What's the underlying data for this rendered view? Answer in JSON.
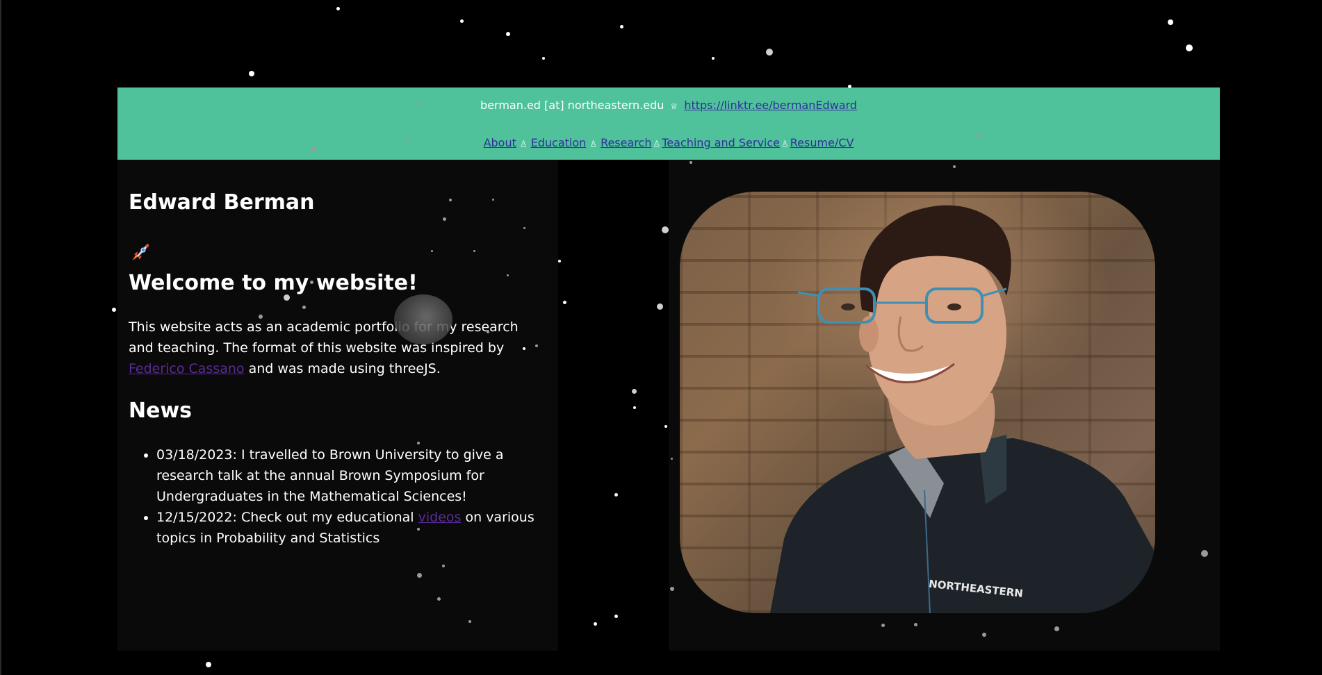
{
  "header": {
    "email": "berman.ed [at] northeastern.edu",
    "separator": "♕",
    "link": "https://linktr.ee/bermanEdward",
    "nav": [
      {
        "label": "About"
      },
      {
        "label": "Education"
      },
      {
        "label": "Research"
      },
      {
        "label": "Teaching and Service"
      },
      {
        "label": "Resume/CV"
      }
    ],
    "nav_separator": "♙"
  },
  "main": {
    "name": "Edward Berman",
    "rocket_emoji": "rocket",
    "welcome": "Welcome to my website!",
    "intro_text": "This website acts as an academic portfolio for my research and teaching. The format of this website was inspired by",
    "intro_link": "Federico Cassano",
    "intro_end": "and was made using threeJS.",
    "news_heading": "News",
    "news": [
      {
        "text": "03/18/2023: I travelled to Brown University to give a research talk at the annual Brown Symposium for Undergraduates in the Mathematical Sciences!"
      },
      {
        "text_before": "12/15/2022: Check out my educational",
        "link": "videos",
        "text_after": "on various topics in Probability and Statistics"
      }
    ]
  },
  "portrait": {
    "shirt_text": "NORTHEASTERN"
  },
  "colors": {
    "header_bg": "#50c29b",
    "link": "#2f2f9a",
    "body_link": "#5b2a98",
    "background": "#000000",
    "panel": "#0a0a0a"
  }
}
